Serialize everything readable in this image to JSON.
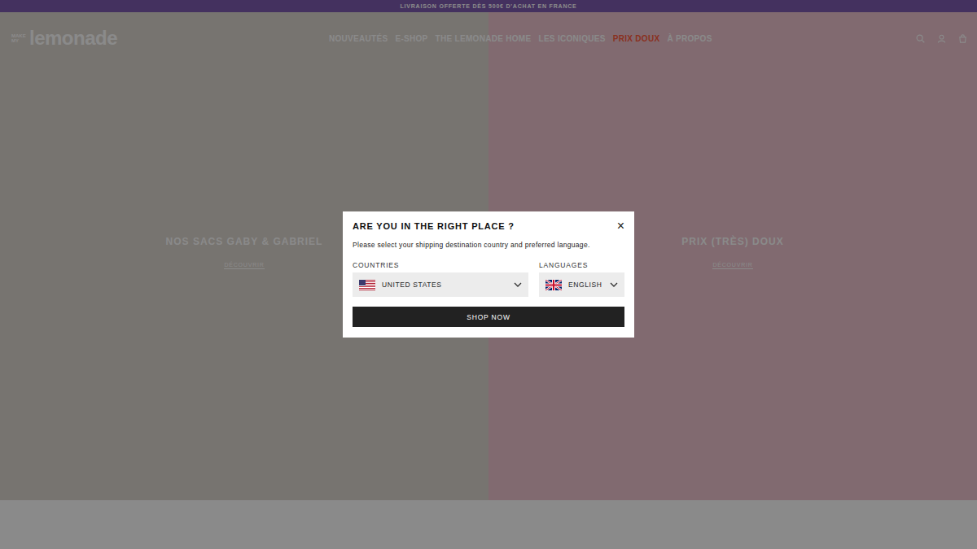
{
  "topbar": {
    "text": "LIVRAISON OFFERTE DÈS 500€ D'ACHAT EN FRANCE"
  },
  "logo": {
    "small": "MAKE MY",
    "main": "lemonade"
  },
  "nav": [
    {
      "label": "NOUVEAUTÉS",
      "color": "#ffffff"
    },
    {
      "label": "E-SHOP",
      "color": "#ffffff"
    },
    {
      "label": "THE LEMONADE HOME",
      "color": "#ffffff"
    },
    {
      "label": "LES ICONIQUES",
      "color": "#ffffff"
    },
    {
      "label": "PRIX DOUX",
      "color": "#ff5a3c"
    },
    {
      "label": "À PROPOS",
      "color": "#ffffff"
    }
  ],
  "slides": [
    {
      "title": "NOS SACS GABY & GABRIEL",
      "link": "DÉCOUVRIR",
      "color": "#ddd6cf"
    },
    {
      "title": "PRIX (TRÈS) DOUX",
      "link": "DÉCOUVRIR",
      "color": "#eec4cf"
    }
  ],
  "modal": {
    "title": "ARE YOU IN THE RIGHT PLACE ?",
    "close": "×",
    "text": "Please select your shipping destination country and preferred language.",
    "countries_label": "COUNTRIES",
    "country": "UNITED STATES",
    "languages_label": "LANGUAGES",
    "language": "ENGLISH",
    "button": "SHOP NOW"
  }
}
